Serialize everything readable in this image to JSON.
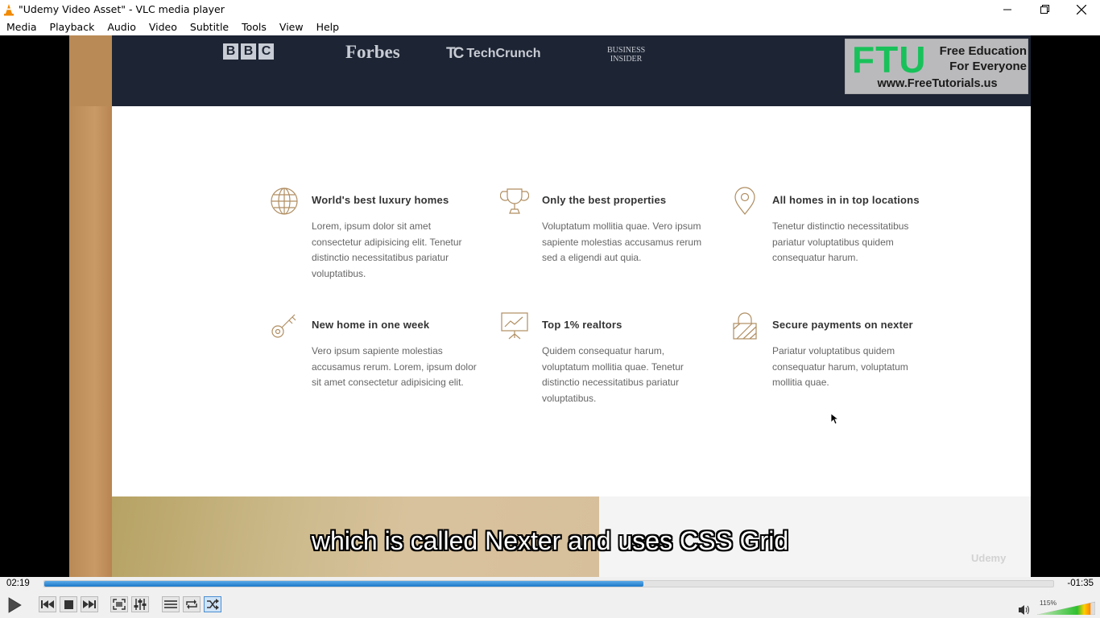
{
  "window": {
    "title": "\"Udemy Video Asset\" - VLC media player",
    "icon": "vlc-cone-icon"
  },
  "menu": [
    "Media",
    "Playback",
    "Audio",
    "Video",
    "Subtitle",
    "Tools",
    "View",
    "Help"
  ],
  "video": {
    "logos": {
      "bbc": [
        "B",
        "B",
        "C"
      ],
      "forbes": "Forbes",
      "techcrunch": "TechCrunch",
      "techcrunch_mark": "TC",
      "business_insider": [
        "BUSINESS",
        "INSIDER"
      ]
    },
    "watermark": {
      "big": "FTU",
      "line1": "Free Education",
      "line2": "For Everyone",
      "url": "www.FreeTutorials.us"
    },
    "features": [
      {
        "icon": "globe-icon",
        "title": "World's best luxury homes",
        "text": "Lorem, ipsum dolor sit amet consectetur adipisicing elit. Tenetur distinctio necessitatibus pariatur voluptatibus."
      },
      {
        "icon": "trophy-icon",
        "title": "Only the best properties",
        "text": "Voluptatum mollitia quae. Vero ipsum sapiente molestias accusamus rerum sed a eligendi aut quia."
      },
      {
        "icon": "map-pin-icon",
        "title": "All homes in in top locations",
        "text": "Tenetur distinctio necessitatibus pariatur voluptatibus quidem consequatur harum."
      },
      {
        "icon": "key-icon",
        "title": "New home in one week",
        "text": "Vero ipsum sapiente molestias accusamus rerum. Lorem, ipsum dolor sit amet consectetur adipisicing elit."
      },
      {
        "icon": "presentation-chart-icon",
        "title": "Top 1% realtors",
        "text": "Quidem consequatur harum, voluptatum mollitia quae. Tenetur distinctio necessitatibus pariatur voluptatibus."
      },
      {
        "icon": "padlock-icon",
        "title": "Secure payments on nexter",
        "text": "Pariatur voluptatibus quidem consequatur harum, voluptatum mollitia quae."
      }
    ],
    "udemy_watermark": "Udemy",
    "subtitle": "which is called Nexter and uses CSS Grid"
  },
  "player": {
    "elapsed": "02:19",
    "remaining": "-01:35",
    "progress": 0.594,
    "volume_label": "115%",
    "volume_level": 1.15,
    "accent_color": "#1d78c9",
    "volume_color": "#2fbf2f"
  }
}
